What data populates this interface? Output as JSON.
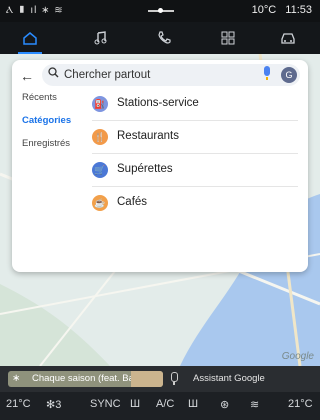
{
  "status": {
    "left_icons": "Ⲁ ▮ ıl ∗ ≋",
    "temperature": "10°C",
    "time": "11:53"
  },
  "topnav": {
    "icons": [
      "home-icon",
      "music-icon",
      "phone-icon",
      "apps-icon",
      "car-icon"
    ]
  },
  "search": {
    "placeholder": "Chercher partout",
    "avatar": "G"
  },
  "sidebar": {
    "items": [
      {
        "label": "Récents"
      },
      {
        "label": "Catégories"
      },
      {
        "label": "Enregistrés"
      }
    ]
  },
  "categories": [
    {
      "label": "Stations-service",
      "icon": "fuel-icon",
      "color": "#7e95e0"
    },
    {
      "label": "Restaurants",
      "icon": "restaurant-icon",
      "color": "#f29a4a"
    },
    {
      "label": "Supérettes",
      "icon": "cart-icon",
      "color": "#4b78d6"
    },
    {
      "label": "Cafés",
      "icon": "coffee-icon",
      "color": "#f2a04a"
    }
  ],
  "map": {
    "attribution": "Google"
  },
  "media": {
    "song": "Chaque saison (feat. Bain"
  },
  "assistant": {
    "label": "Assistant Google"
  },
  "hvac": {
    "left_temp": "21°C",
    "fan": "3",
    "sync": "SYNC",
    "ac": "A/C",
    "right_temp": "21°C"
  },
  "colors": {
    "accent": "#1a73e8",
    "nav_active": "#2a8cff"
  }
}
